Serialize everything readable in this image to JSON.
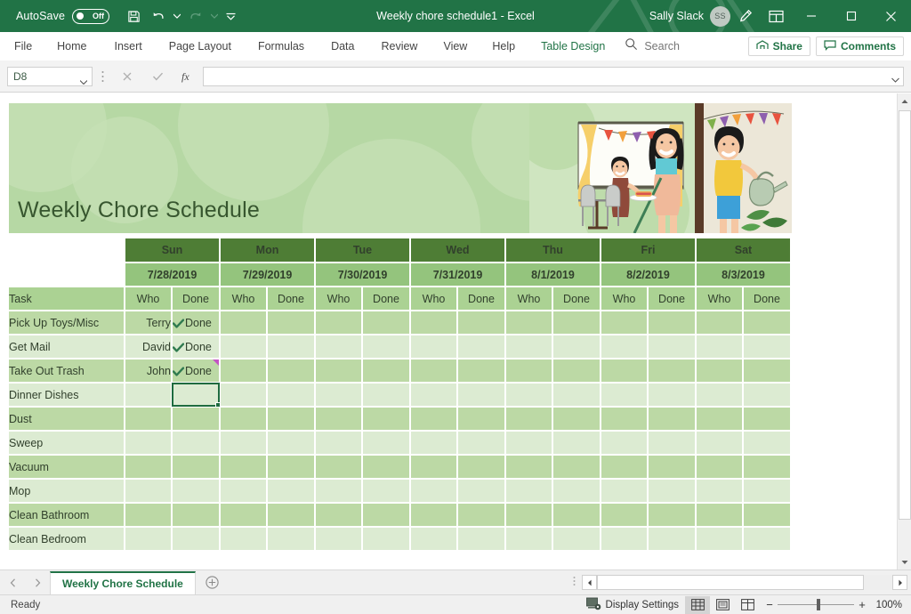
{
  "titlebar": {
    "autosave_label": "AutoSave",
    "autosave_state": "Off",
    "document_title": "Weekly chore schedule1  -  Excel",
    "user_name": "Sally Slack",
    "avatar_initials": "SS",
    "quick_access": [
      {
        "name": "save-icon",
        "label": "Save"
      },
      {
        "name": "undo-icon",
        "label": "Undo"
      },
      {
        "name": "redo-icon",
        "label": "Redo"
      },
      {
        "name": "customize-quick-access-icon",
        "label": "Customize Quick Access Toolbar"
      }
    ],
    "window_buttons": {
      "minimize": "–",
      "maximize": "□",
      "close": "✕"
    },
    "accent_color": "#217346"
  },
  "ribbon": {
    "tabs": [
      {
        "label": "File",
        "active": false,
        "contextual": false
      },
      {
        "label": "Home",
        "active": false,
        "contextual": false
      },
      {
        "label": "Insert",
        "active": false,
        "contextual": false
      },
      {
        "label": "Page Layout",
        "active": false,
        "contextual": false
      },
      {
        "label": "Formulas",
        "active": false,
        "contextual": false
      },
      {
        "label": "Data",
        "active": false,
        "contextual": false
      },
      {
        "label": "Review",
        "active": false,
        "contextual": false
      },
      {
        "label": "View",
        "active": false,
        "contextual": false
      },
      {
        "label": "Help",
        "active": false,
        "contextual": false
      },
      {
        "label": "Table Design",
        "active": false,
        "contextual": true
      }
    ],
    "search_placeholder": "Search",
    "share_label": "Share",
    "comments_label": "Comments"
  },
  "formula_bar": {
    "name_box_value": "D8",
    "cancel_label": "✕",
    "enter_label": "✓",
    "function_label": "fx",
    "formula_value": ""
  },
  "banner": {
    "title": "Weekly Chore Schedule",
    "background_color": "#b6d8a4",
    "title_color": "#37562f"
  },
  "table": {
    "task_header": "Task",
    "col_who": "Who",
    "col_done": "Done",
    "days": [
      {
        "day": "Sun",
        "date": "7/28/2019"
      },
      {
        "day": "Mon",
        "date": "7/29/2019"
      },
      {
        "day": "Tue",
        "date": "7/30/2019"
      },
      {
        "day": "Wed",
        "date": "7/31/2019"
      },
      {
        "day": "Thu",
        "date": "8/1/2019"
      },
      {
        "day": "Fri",
        "date": "8/2/2019"
      },
      {
        "day": "Sat",
        "date": "8/3/2019"
      }
    ],
    "header_color": "#4e7d35",
    "date_row_color": "#94c47d",
    "subheader_color": "#abd293",
    "band_odd_color": "#bcd9a5",
    "band_even_color": "#dcebd2",
    "rows": [
      {
        "task": "Pick Up Toys/Misc",
        "sun_who": "Terry",
        "sun_done": "Done"
      },
      {
        "task": "Get Mail",
        "sun_who": "David",
        "sun_done": "Done"
      },
      {
        "task": "Take Out Trash",
        "sun_who": "John",
        "sun_done": "Done"
      },
      {
        "task": "Dinner Dishes",
        "sun_who": "",
        "sun_done": ""
      },
      {
        "task": "Dust",
        "sun_who": "",
        "sun_done": ""
      },
      {
        "task": "Sweep",
        "sun_who": "",
        "sun_done": ""
      },
      {
        "task": "Vacuum",
        "sun_who": "",
        "sun_done": ""
      },
      {
        "task": "Mop",
        "sun_who": "",
        "sun_done": ""
      },
      {
        "task": "Clean Bathroom",
        "sun_who": "",
        "sun_done": ""
      },
      {
        "task": "Clean Bedroom",
        "sun_who": "",
        "sun_done": ""
      }
    ],
    "selected_cell": "D8",
    "comment_indicator_color": "#c455c4",
    "selection_border_color": "#1e6b3f"
  },
  "sheet_tabs": {
    "tabs": [
      {
        "label": "Weekly Chore Schedule",
        "active": true
      }
    ],
    "add_sheet_label": "+"
  },
  "status_bar": {
    "status_text": "Ready",
    "display_settings_label": "Display Settings",
    "views": [
      {
        "name": "normal-view-button",
        "active": true
      },
      {
        "name": "page-layout-view-button",
        "active": false
      },
      {
        "name": "page-break-preview-button",
        "active": false
      }
    ],
    "zoom_out_label": "−",
    "zoom_in_label": "+",
    "zoom_level": "100%"
  }
}
